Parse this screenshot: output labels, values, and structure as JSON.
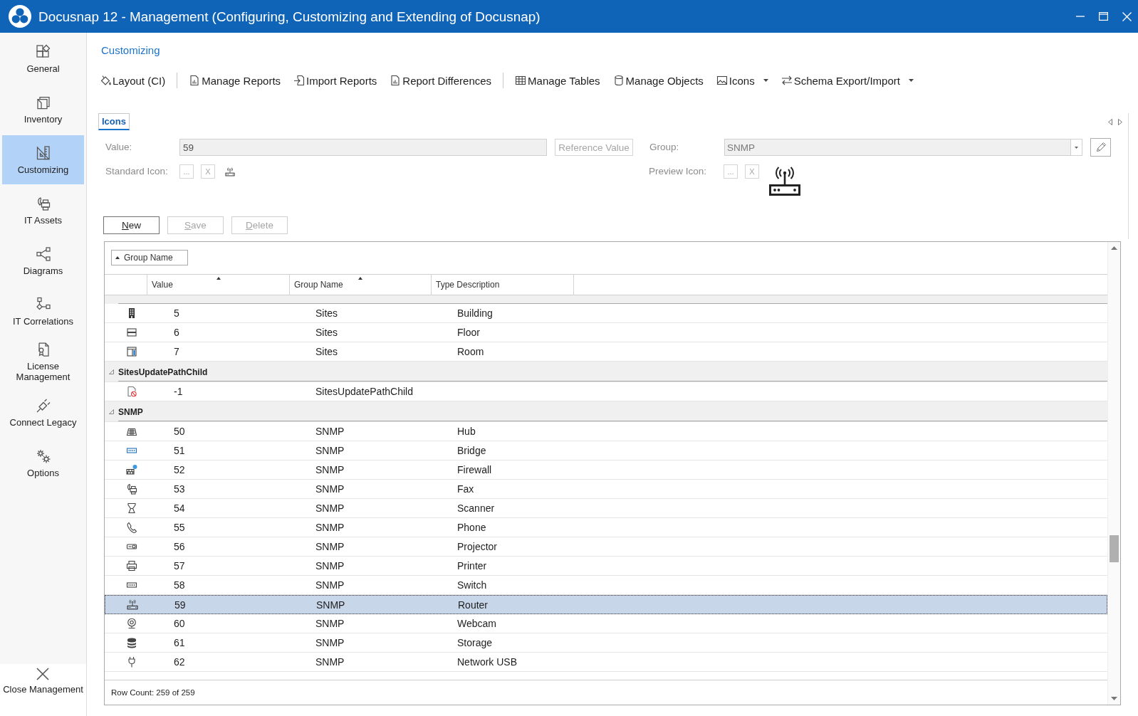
{
  "window": {
    "title": "Docusnap 12 - Management (Configuring, Customizing and Extending of Docusnap)"
  },
  "sidebar": {
    "items": [
      {
        "label": "General",
        "selected": false
      },
      {
        "label": "Inventory",
        "selected": false
      },
      {
        "label": "Customizing",
        "selected": true
      },
      {
        "label": "IT Assets",
        "selected": false
      },
      {
        "label": "Diagrams",
        "selected": false
      },
      {
        "label": "IT Correlations",
        "selected": false
      },
      {
        "label": "License Management",
        "selected": false
      },
      {
        "label": "Connect Legacy",
        "selected": false
      },
      {
        "label": "Options",
        "selected": false
      }
    ],
    "close_button": "Close Management"
  },
  "section_title": "Customizing",
  "toolbar": {
    "groups": [
      {
        "items": [
          {
            "label": "Layout (CI)",
            "kind": "button"
          }
        ]
      },
      {
        "items": [
          {
            "label": "Manage Reports",
            "kind": "button"
          },
          {
            "label": "Import Reports",
            "kind": "button"
          },
          {
            "label": "Report Differences",
            "kind": "button"
          }
        ]
      },
      {
        "items": [
          {
            "label": "Manage Tables",
            "kind": "button"
          },
          {
            "label": "Manage Objects",
            "kind": "button"
          },
          {
            "label": "Icons",
            "kind": "dropdown"
          },
          {
            "label": "Schema Export/Import",
            "kind": "dropdown"
          }
        ]
      }
    ]
  },
  "tabs": [
    {
      "label": "Icons",
      "selected": true
    }
  ],
  "form": {
    "value": {
      "label": "Value:",
      "value": "59",
      "disabled": true
    },
    "reference_button": {
      "label": "Reference Value",
      "disabled": true
    },
    "group": {
      "label": "Group:",
      "value": "SNMP",
      "disabled": true
    },
    "standard_icon": {
      "label": "Standard Icon:",
      "browse_button": "...",
      "clear_button": "X",
      "disabled": true
    },
    "preview_icon": {
      "label": "Preview Icon:",
      "browse_button": "...",
      "clear_button": "X",
      "disabled": true
    }
  },
  "actions": [
    {
      "label": "New",
      "disabled": false
    },
    {
      "label": "Save",
      "disabled": true
    },
    {
      "label": "Delete",
      "disabled": true
    }
  ],
  "grid": {
    "group_panel": [
      {
        "label": "Group Name",
        "sorted": true
      }
    ],
    "columns": [
      {
        "label": "Value",
        "sorted": true
      },
      {
        "label": "Group Name",
        "sorted": true
      },
      {
        "label": "Type Description",
        "sorted": false
      }
    ],
    "rows": [
      {
        "kind": "row",
        "value": "5",
        "group_name": "Sites",
        "type_description": "Building",
        "selected": false
      },
      {
        "kind": "row",
        "value": "6",
        "group_name": "Sites",
        "type_description": "Floor",
        "selected": false
      },
      {
        "kind": "row",
        "value": "7",
        "group_name": "Sites",
        "type_description": "Room",
        "selected": false
      },
      {
        "kind": "group",
        "name": "SitesUpdatePathChild",
        "expanded": true
      },
      {
        "kind": "row",
        "value": "-1",
        "group_name": "SitesUpdatePathChild",
        "selected": false
      },
      {
        "kind": "group",
        "name": "SNMP",
        "expanded": true
      },
      {
        "kind": "row",
        "value": "50",
        "group_name": "SNMP",
        "type_description": "Hub",
        "selected": false
      },
      {
        "kind": "row",
        "value": "51",
        "group_name": "SNMP",
        "type_description": "Bridge",
        "selected": false
      },
      {
        "kind": "row",
        "value": "52",
        "group_name": "SNMP",
        "type_description": "Firewall",
        "selected": false
      },
      {
        "kind": "row",
        "value": "53",
        "group_name": "SNMP",
        "type_description": "Fax",
        "selected": false
      },
      {
        "kind": "row",
        "value": "54",
        "group_name": "SNMP",
        "type_description": "Scanner",
        "selected": false
      },
      {
        "kind": "row",
        "value": "55",
        "group_name": "SNMP",
        "type_description": "Phone",
        "selected": false
      },
      {
        "kind": "row",
        "value": "56",
        "group_name": "SNMP",
        "type_description": "Projector",
        "selected": false
      },
      {
        "kind": "row",
        "value": "57",
        "group_name": "SNMP",
        "type_description": "Printer",
        "selected": false
      },
      {
        "kind": "row",
        "value": "58",
        "group_name": "SNMP",
        "type_description": "Switch",
        "selected": false
      },
      {
        "kind": "row",
        "value": "59",
        "group_name": "SNMP",
        "type_description": "Router",
        "selected": true
      },
      {
        "kind": "row",
        "value": "60",
        "group_name": "SNMP",
        "type_description": "Webcam",
        "selected": false
      },
      {
        "kind": "row",
        "value": "61",
        "group_name": "SNMP",
        "type_description": "Storage",
        "selected": false
      },
      {
        "kind": "row",
        "value": "62",
        "group_name": "SNMP",
        "type_description": "Network USB",
        "selected": false
      }
    ],
    "row_count": "Row Count: 259 of 259"
  }
}
